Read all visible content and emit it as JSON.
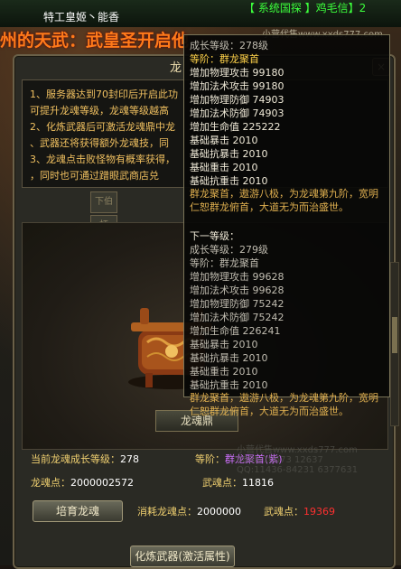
{
  "top": {
    "player_name": "特工皇姬丶能香",
    "system_message": "【 系统国探 】鸡毛信】2",
    "scroll_text": "州的天武：武皇圣开启他"
  },
  "panel": {
    "title": "龙",
    "close_label": "×",
    "description": [
      "1、服务器达到70封印后开启此功",
      "可提升龙魂等级，龙魂等级越高",
      "2、化炼武器后可激活龙魂鼎中龙",
      "、武器还将获得额外龙魂技，同",
      "3、龙魂点击败怪物有概率获得，",
      "，同时也可通过蹭眼武商店兑"
    ],
    "slot_labels": [
      "下伯",
      "杆"
    ],
    "ding_label": "龙魂鼎"
  },
  "stats": {
    "growth_level_label": "当前龙魂成长等级：",
    "growth_level_value": "278",
    "rank_label": "等阶：",
    "rank_value": "群龙聚首(紫)",
    "dragon_points_label": "龙魂点：",
    "dragon_points_value": "2000002572",
    "weapon_points_label": "武魂点：",
    "weapon_points_value": "11816",
    "cost_dragon_label": "消耗龙魂点：",
    "cost_dragon_value": "2000000",
    "cost_weapon_label": "武魂点：",
    "cost_weapon_value": "19369",
    "cost_weapon_color": "#ff3030"
  },
  "buttons": {
    "cultivate": "培育龙魂",
    "refine": "化炼武器(激活属性)"
  },
  "watermark": {
    "lines": [
      "小营代售www.xxds777.com",
      "0888-10673 12637",
      "QQ:11436-84231 6377631"
    ]
  },
  "tooltip": {
    "site": "小营代售www.xxds777.com",
    "current": [
      {
        "text": "成长等级：278级",
        "style": "gray"
      },
      {
        "text": "等阶：群龙聚首",
        "style": "gray"
      },
      {
        "text": "增加物理攻击 99180",
        "style": "white"
      },
      {
        "text": "增加法术攻击 99180",
        "style": "white"
      },
      {
        "text": "增加物理防御 74903",
        "style": "white"
      },
      {
        "text": "增加法术防御 74903",
        "style": "white"
      },
      {
        "text": "增加生命值 225222",
        "style": "white"
      },
      {
        "text": "基础暴击 2010",
        "style": "white"
      },
      {
        "text": "基础抗暴击 2010",
        "style": "white"
      },
      {
        "text": "基础重击 2010",
        "style": "white"
      },
      {
        "text": "基础抗重击 2010",
        "style": "white"
      }
    ],
    "current_lore": "群龙聚首，遨游八极，为龙魂第九阶，宽明仁恕群龙俯首，大道无为而治盛世。",
    "next_header": "下一等级：",
    "next": [
      {
        "text": "成长等级：279级",
        "style": "gray"
      },
      {
        "text": "等阶：群龙聚首",
        "style": "gray"
      },
      {
        "text": "增加物理攻击 99628",
        "style": "gray"
      },
      {
        "text": "增加法术攻击 99628",
        "style": "gray"
      },
      {
        "text": "增加物理防御 75242",
        "style": "gray"
      },
      {
        "text": "增加法术防御 75242",
        "style": "gray"
      },
      {
        "text": "增加生命值 226241",
        "style": "gray"
      },
      {
        "text": "基础暴击 2010",
        "style": "gray"
      },
      {
        "text": "基础抗暴击 2010",
        "style": "gray"
      },
      {
        "text": "基础重击 2010",
        "style": "gray"
      },
      {
        "text": "基础抗重击 2010",
        "style": "gray"
      }
    ],
    "next_lore": "群龙聚首，遨游八极，为龙魂第九阶，宽明仁恕群龙俯首，大道无为而治盛世。"
  }
}
